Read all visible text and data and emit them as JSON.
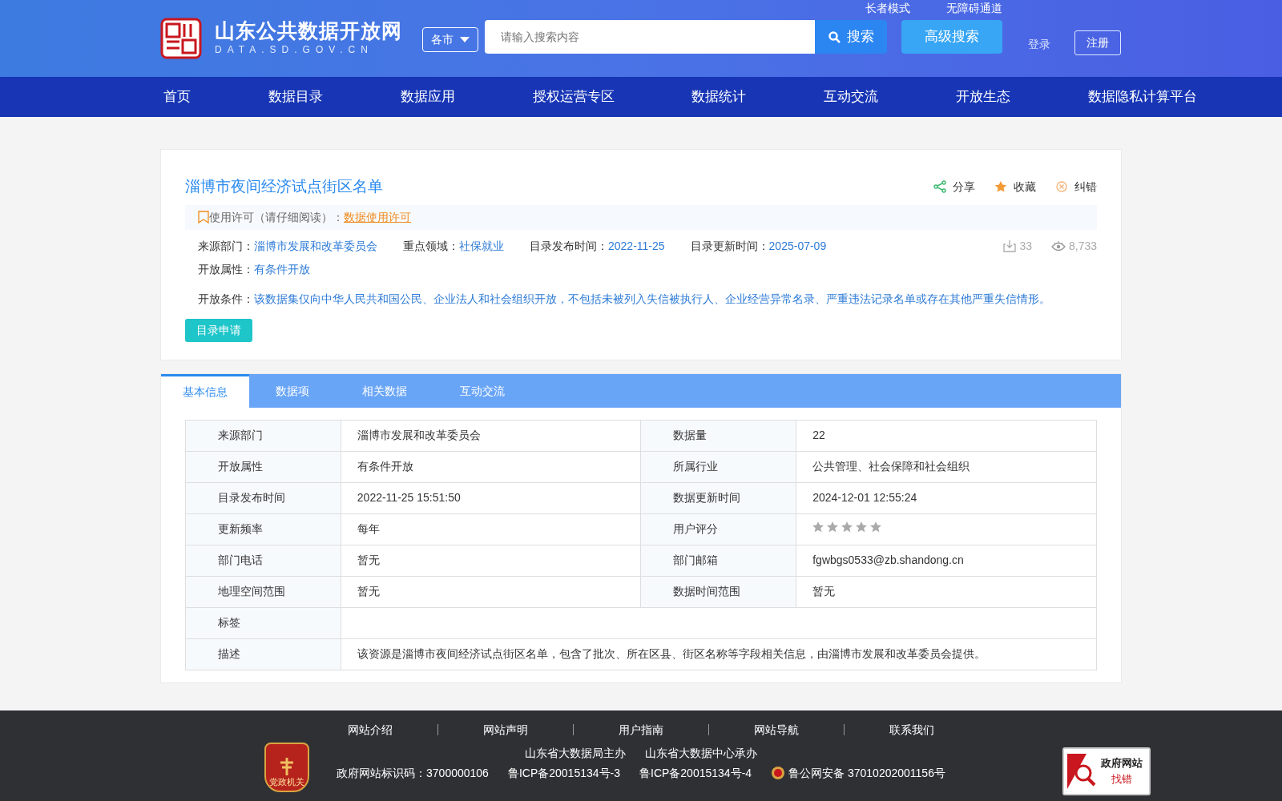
{
  "header": {
    "site_title": "山东公共数据开放网",
    "site_subtitle": "DATA.SD.GOV.CN",
    "top_links": [
      "长者模式",
      "无障碍通道"
    ],
    "city_select": "各市",
    "search": {
      "placeholder": "请输入搜索内容",
      "button": "搜索"
    },
    "advanced_search": "高级搜索",
    "login": "登录",
    "register": "注册"
  },
  "nav": [
    "首页",
    "数据目录",
    "数据应用",
    "授权运营专区",
    "数据统计",
    "互动交流",
    "开放生态",
    "数据隐私计算平台"
  ],
  "dataset": {
    "title": "淄博市夜间经济试点街区名单",
    "actions": [
      {
        "kind": "share",
        "label": "分享"
      },
      {
        "kind": "favorite",
        "label": "收藏"
      },
      {
        "kind": "report",
        "label": "纠错"
      }
    ],
    "license": {
      "label": "使用许可（请仔细阅读）：",
      "link": "数据使用许可"
    },
    "meta": [
      {
        "label": "来源部门：",
        "value": "淄博市发展和改革委员会"
      },
      {
        "label": "重点领域：",
        "value": "社保就业"
      },
      {
        "label": "目录发布时间：",
        "value": "2022-11-25"
      },
      {
        "label": "目录更新时间：",
        "value": "2025-07-09"
      }
    ],
    "downloads": "33",
    "views": "8,733",
    "open_attr": {
      "label": "开放属性：",
      "value": "有条件开放"
    },
    "condition": {
      "label": "开放条件：",
      "value": "该数据集仅向中华人民共和国公民、企业法人和社会组织开放，不包括未被列入失信被执行人、企业经营异常名录、严重违法记录名单或存在其他严重失信情形。"
    },
    "apply_button": "目录申请"
  },
  "tabs": [
    {
      "label": "基本信息",
      "selected": true
    },
    {
      "label": "数据项",
      "selected": false
    },
    {
      "label": "相关数据",
      "selected": false
    },
    {
      "label": "互动交流",
      "selected": false
    }
  ],
  "table": [
    [
      {
        "label": "来源部门",
        "value": "淄博市发展和改革委员会"
      },
      {
        "label": "数据量",
        "value": "22"
      }
    ],
    [
      {
        "label": "开放属性",
        "value": "有条件开放"
      },
      {
        "label": "所属行业",
        "value": "公共管理、社会保障和社会组织"
      }
    ],
    [
      {
        "label": "目录发布时间",
        "value": "2022-11-25 15:51:50"
      },
      {
        "label": "数据更新时间",
        "value": "2024-12-01 12:55:24"
      }
    ],
    [
      {
        "label": "更新频率",
        "value": "每年"
      },
      {
        "label": "用户评分",
        "stars": 0
      }
    ],
    [
      {
        "label": "部门电话",
        "value": "暂无"
      },
      {
        "label": "部门邮箱",
        "value": "fgwbgs0533@zb.shandong.cn"
      }
    ],
    [
      {
        "label": "地理空间范围",
        "value": "暂无"
      },
      {
        "label": "数据时间范围",
        "value": "暂无"
      }
    ],
    [
      {
        "label": "标签"
      }
    ],
    [
      {
        "label": "描述",
        "value": "该资源是淄博市夜间经济试点街区名单，包含了批次、所在区县、街区名称等字段相关信息，由淄博市发展和改革委员会提供。"
      }
    ]
  ],
  "footer": {
    "links": [
      "网站介绍",
      "网站声明",
      "用户指南",
      "网站导航",
      "联系我们"
    ],
    "hosts": [
      "山东省大数据局主办",
      "山东省大数据中心承办"
    ],
    "records": [
      "政府网站标识码：3700000106",
      "鲁ICP备20015134号-3",
      "鲁ICP备20015134号-4",
      "鲁公网安备 37010202001156号"
    ],
    "party_badge": "党政机关",
    "gov_badge": {
      "title": "政府网站",
      "action": "找错"
    }
  }
}
